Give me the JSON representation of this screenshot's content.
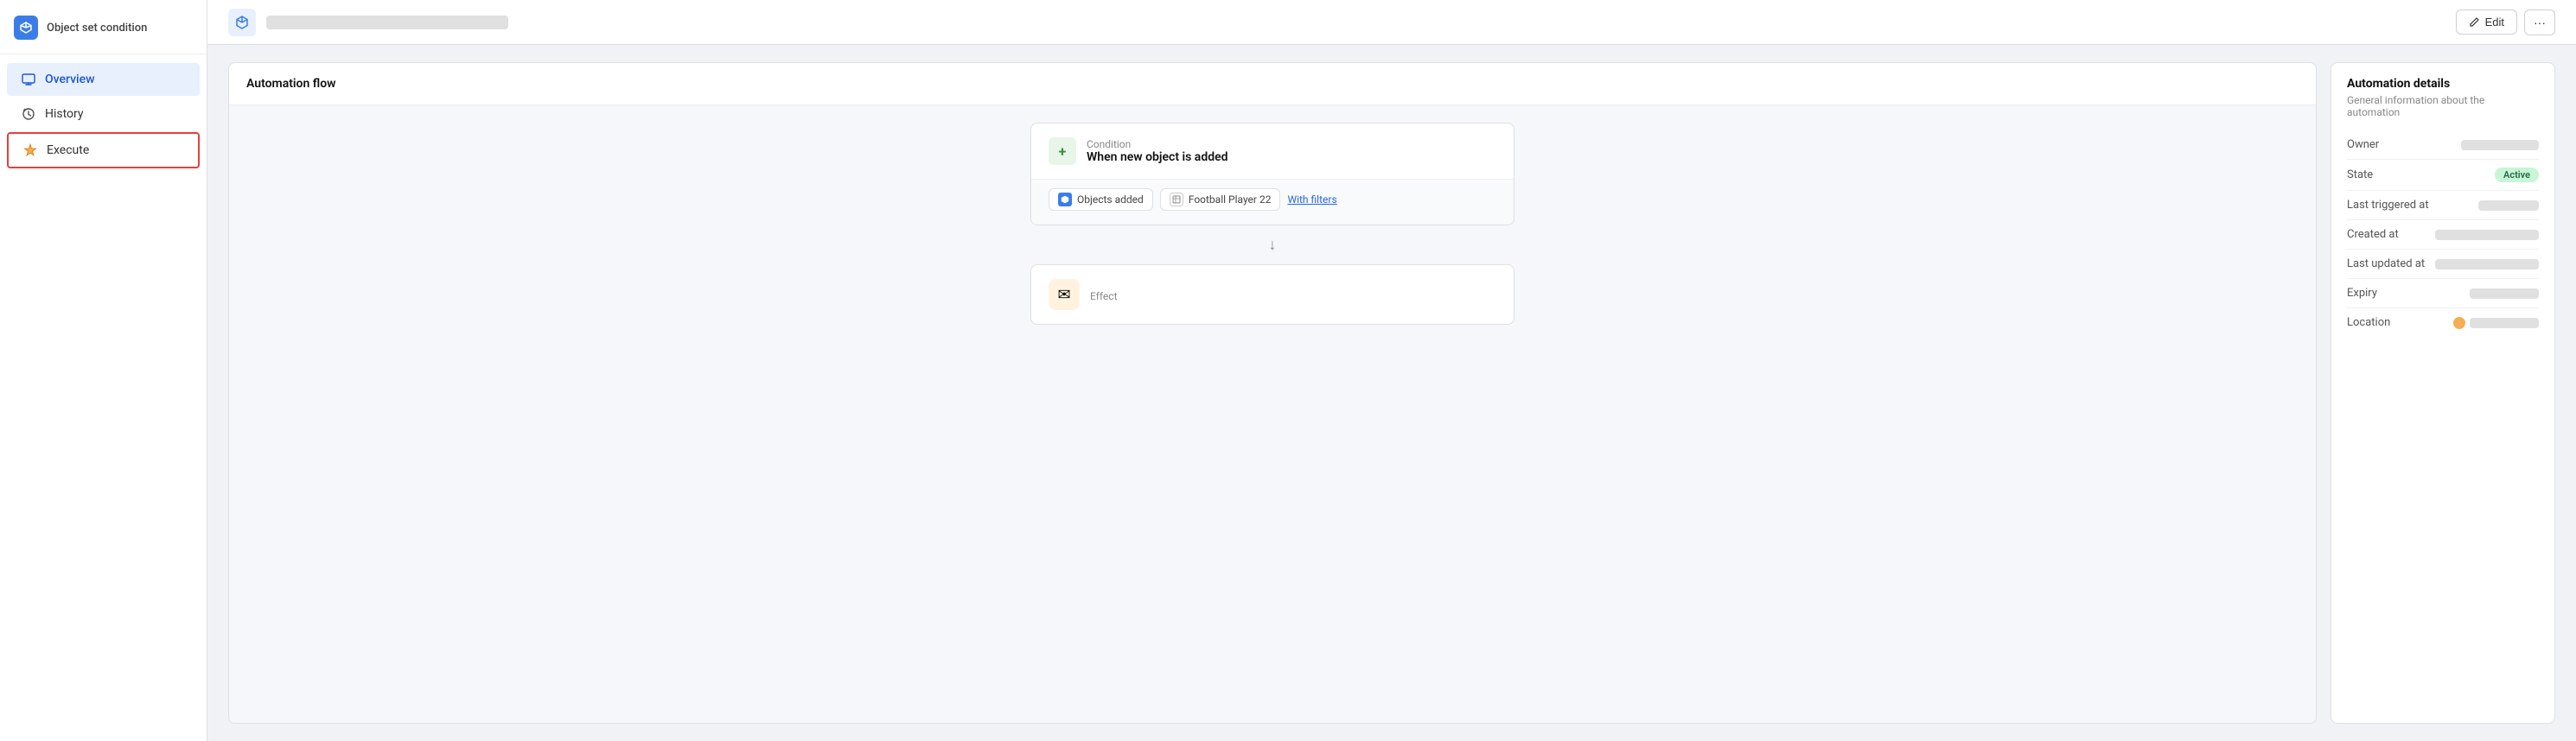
{
  "sidebar": {
    "logo_alt": "app-logo",
    "title": "Object set condition",
    "nav_items": [
      {
        "id": "overview",
        "label": "Overview",
        "icon": "monitor-icon",
        "active": true,
        "execute_active": false
      },
      {
        "id": "history",
        "label": "History",
        "icon": "history-icon",
        "active": false,
        "execute_active": false
      },
      {
        "id": "execute",
        "label": "Execute",
        "icon": "execute-icon",
        "active": false,
        "execute_active": true
      }
    ]
  },
  "topbar": {
    "title_placeholder": "",
    "edit_label": "Edit",
    "more_label": "···"
  },
  "flow": {
    "panel_title": "Automation flow",
    "condition": {
      "label": "Condition",
      "value": "When new object is added",
      "tags": [
        {
          "id": "objects-added",
          "label": "Objects added",
          "icon_type": "app"
        },
        {
          "id": "football-player-22",
          "label": "Football Player 22",
          "icon_type": "table"
        }
      ],
      "filters_label": "With filters"
    },
    "arrow": "↓",
    "effect": {
      "label": "Effect",
      "icon": "✉"
    }
  },
  "details": {
    "title": "Automation details",
    "subtitle": "General information about the automation",
    "rows": [
      {
        "key": "Owner",
        "value_width": "90px",
        "type": "redacted"
      },
      {
        "key": "State",
        "value_width": "50px",
        "type": "badge",
        "badge_text": "Active"
      },
      {
        "key": "Last triggered at",
        "value_width": "70px",
        "type": "redacted"
      },
      {
        "key": "Created at",
        "value_width": "120px",
        "type": "redacted"
      },
      {
        "key": "Last updated at",
        "value_width": "120px",
        "type": "redacted"
      },
      {
        "key": "Expiry",
        "value_width": "80px",
        "type": "redacted"
      },
      {
        "key": "Location",
        "value_width": "80px",
        "type": "location"
      }
    ]
  }
}
